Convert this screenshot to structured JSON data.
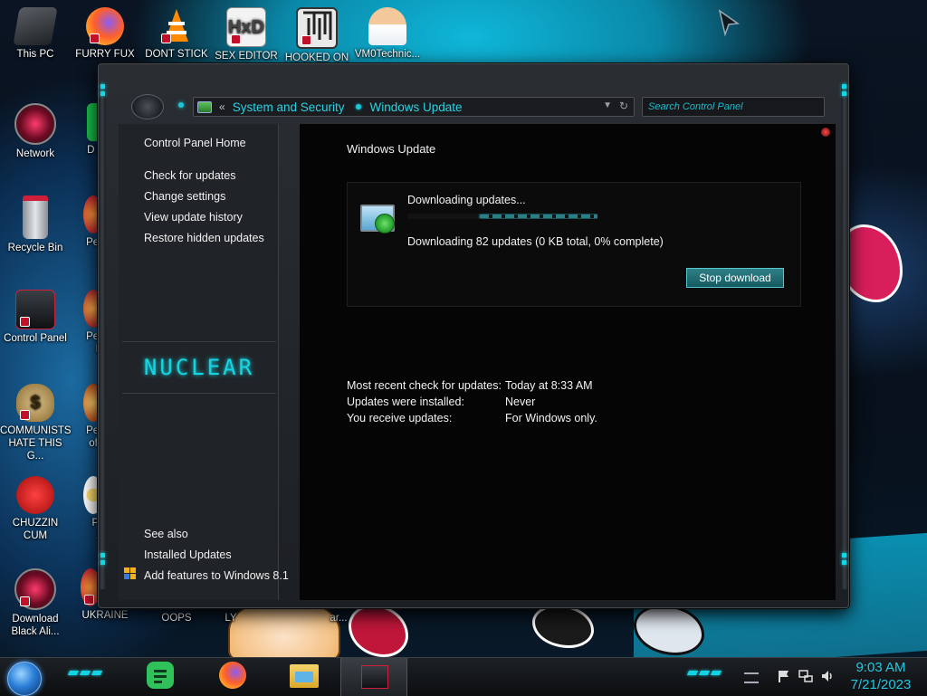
{
  "desktop": {
    "icons": [
      {
        "label": "This PC"
      },
      {
        "label": "FURRY FUX"
      },
      {
        "label": "DONT STICK"
      },
      {
        "label": "SEX EDITOR"
      },
      {
        "label": "HOOKED ON"
      },
      {
        "label": "VM0Technic..."
      },
      {
        "label": "Network"
      },
      {
        "label": "D DUM"
      },
      {
        "label": "Recycle Bin"
      },
      {
        "label": "Peggle"
      },
      {
        "label": "Control Panel"
      },
      {
        "label": "Peggle De"
      },
      {
        "label": "COMMUNISTS HATE THIS G..."
      },
      {
        "label": "Peggle of Wa"
      },
      {
        "label": "CHUZZIN CUM"
      },
      {
        "label": "Plan Zo"
      },
      {
        "label": "Download Black Ali..."
      },
      {
        "label": "UKRAINE"
      },
      {
        "label": "OOPS"
      },
      {
        "label": "LY"
      },
      {
        "label": "ar..."
      }
    ]
  },
  "window": {
    "breadcrumb": [
      "System and Security",
      "Windows Update"
    ],
    "search_placeholder": "Search Control Panel",
    "sidebar": {
      "home": "Control Panel Home",
      "links": [
        "Check for updates",
        "Change settings",
        "View update history",
        "Restore hidden updates"
      ],
      "logo": "NUCLEAR",
      "see_also_heading": "See also",
      "see_also": [
        "Installed Updates",
        "Add features to Windows 8.1"
      ]
    },
    "main": {
      "title": "Windows Update",
      "download": {
        "heading": "Downloading updates...",
        "status": "Downloading 82 updates (0 KB total, 0% complete)",
        "progress_percent": 0,
        "stop_button": "Stop download"
      },
      "info": [
        {
          "label": "Most recent check for updates:",
          "value": "Today at 8:33 AM"
        },
        {
          "label": "Updates were installed:",
          "value": "Never"
        },
        {
          "label": "You receive updates:",
          "value": "For Windows only."
        }
      ]
    }
  },
  "taskbar": {
    "pinned": [
      "messaging-icon",
      "firefox-icon",
      "file-explorer-icon",
      "control-panel-icon"
    ],
    "time": "9:03 AM",
    "date": "7/21/2023"
  },
  "colors": {
    "accent": "#19c9d9",
    "window_bg": "#202327",
    "content_bg": "#050505"
  }
}
